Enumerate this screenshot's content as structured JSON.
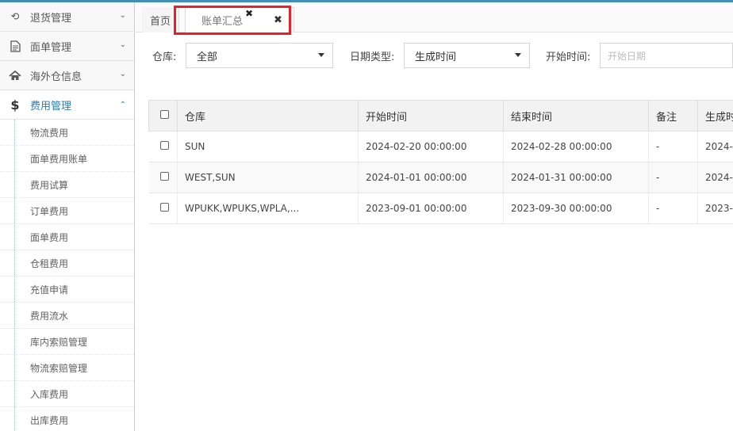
{
  "sidebar": {
    "menus": [
      {
        "label": "退货管理",
        "icon": "undo-icon",
        "glyph": "⟲"
      },
      {
        "label": "面单管理",
        "icon": "document-icon",
        "glyph": "🗎"
      },
      {
        "label": "海外仓信息",
        "icon": "home-icon",
        "glyph": "⌂"
      },
      {
        "label": "费用管理",
        "icon": "dollar-icon",
        "glyph": "$"
      }
    ],
    "submenu": [
      "物流费用",
      "面单费用账单",
      "费用试算",
      "订单费用",
      "面单费用",
      "仓租费用",
      "充值申请",
      "费用流水",
      "库内索赔管理",
      "物流索赔管理",
      "入库费用",
      "出库费用"
    ]
  },
  "tabs": {
    "home": "首页",
    "active": "账单汇总",
    "close_glyph": "✖"
  },
  "filters": {
    "warehouse_label": "仓库:",
    "warehouse_value": "全部",
    "date_type_label": "日期类型:",
    "date_type_value": "生成时间",
    "start_time_label": "开始时间:",
    "start_date_placeholder": "开始日期"
  },
  "table": {
    "headers": [
      "仓库",
      "开始时间",
      "结束时间",
      "备注",
      "生成时"
    ],
    "rows": [
      [
        "SUN",
        "2024-02-20 00:00:00",
        "2024-02-28 00:00:00",
        "-",
        "2024-"
      ],
      [
        "WEST,SUN",
        "2024-01-01 00:00:00",
        "2024-01-31 00:00:00",
        "-",
        "2024-"
      ],
      [
        "WPUKK,WPUKS,WPLA,...",
        "2023-09-01 00:00:00",
        "2023-09-30 00:00:00",
        "-",
        "2023-"
      ]
    ]
  },
  "colors": {
    "accent": "#2b7dbc",
    "highlight": "#e8202a"
  }
}
